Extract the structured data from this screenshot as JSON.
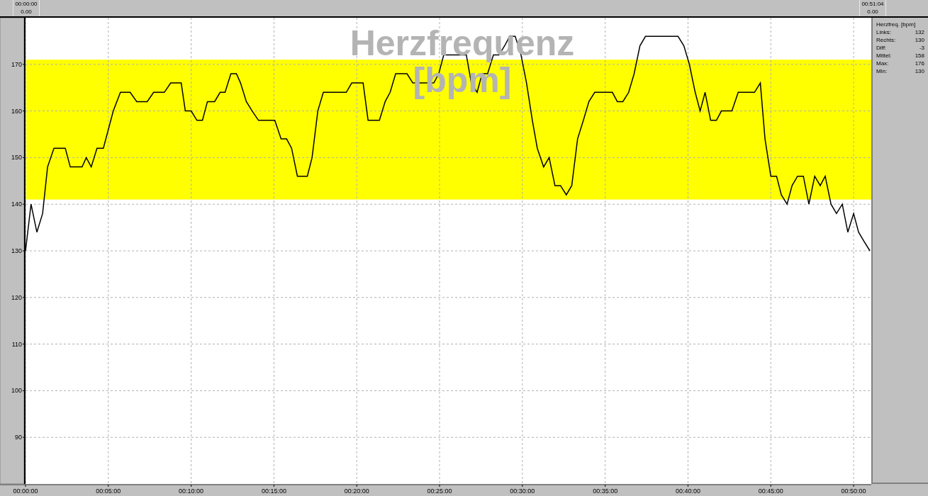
{
  "cursors": [
    {
      "time": "00:00:00",
      "value": "0.00"
    },
    {
      "time": "00:51:04",
      "value": "0.00"
    }
  ],
  "chart": {
    "chart_data": {
      "type": "line",
      "title": "Herzfrequenz [bpm]",
      "xlim": [
        0,
        3064
      ],
      "ylim": [
        80,
        180
      ],
      "xticks": [
        {
          "value": 0,
          "label": "00:00:00"
        },
        {
          "value": 300,
          "label": "00:05:00"
        },
        {
          "value": 600,
          "label": "00:10:00"
        },
        {
          "value": 900,
          "label": "00:15:00"
        },
        {
          "value": 1200,
          "label": "00:20:00"
        },
        {
          "value": 1500,
          "label": "00:25:00"
        },
        {
          "value": 1800,
          "label": "00:30:00"
        },
        {
          "value": 2100,
          "label": "00:35:00"
        },
        {
          "value": 2400,
          "label": "00:40:00"
        },
        {
          "value": 2700,
          "label": "00:45:00"
        },
        {
          "value": 3000,
          "label": "00:50:00"
        }
      ],
      "yticks": [
        90,
        100,
        110,
        120,
        130,
        140,
        150,
        160,
        170
      ],
      "grid": true,
      "bands": [
        {
          "axis": "y",
          "from": 141,
          "to": 171,
          "color": "#ffff00"
        }
      ],
      "x": [
        0,
        20,
        41,
        62,
        80,
        103,
        144,
        162,
        205,
        220,
        238,
        259,
        282,
        318,
        344,
        379,
        403,
        441,
        464,
        503,
        526,
        564,
        579,
        600,
        621,
        641,
        659,
        685,
        705,
        723,
        744,
        764,
        779,
        800,
        821,
        844,
        903,
        926,
        946,
        964,
        985,
        1021,
        1038,
        1059,
        1079,
        1162,
        1182,
        1223,
        1241,
        1282,
        1303,
        1321,
        1341,
        1382,
        1403,
        1479,
        1497,
        1515,
        1597,
        1615,
        1636,
        1654,
        1674,
        1695,
        1715,
        1736,
        1754,
        1774,
        1795,
        1815,
        1836,
        1854,
        1877,
        1897,
        1918,
        1938,
        1959,
        1979,
        2000,
        2021,
        2041,
        2062,
        2126,
        2144,
        2164,
        2185,
        2205,
        2226,
        2246,
        2364,
        2385,
        2405,
        2426,
        2444,
        2462,
        2482,
        2503,
        2521,
        2559,
        2582,
        2641,
        2662,
        2679,
        2700,
        2721,
        2738,
        2759,
        2777,
        2797,
        2818,
        2838,
        2859,
        2879,
        2897,
        2918,
        2938,
        2959,
        2979,
        3000,
        3018,
        3038,
        3059
      ],
      "series": [
        {
          "color": "#000000",
          "values": [
            130,
            140,
            134,
            138,
            148,
            152,
            152,
            148,
            148,
            150,
            148,
            152,
            152,
            160,
            164,
            164,
            162,
            162,
            164,
            164,
            166,
            166,
            160,
            160,
            158,
            158,
            162,
            162,
            164,
            164,
            168,
            168,
            166,
            162,
            160,
            158,
            158,
            154,
            154,
            152,
            146,
            146,
            150,
            160,
            164,
            164,
            166,
            166,
            158,
            158,
            162,
            164,
            168,
            168,
            166,
            166,
            168,
            172,
            172,
            166,
            164,
            168,
            168,
            172,
            172,
            174,
            176,
            176,
            172,
            166,
            158,
            152,
            148,
            150,
            144,
            144,
            142,
            144,
            154,
            158,
            162,
            164,
            164,
            162,
            162,
            164,
            168,
            174,
            176,
            176,
            174,
            170,
            164,
            160,
            164,
            158,
            158,
            160,
            160,
            164,
            164,
            166,
            154,
            146,
            146,
            142,
            140,
            144,
            146,
            146,
            140,
            146,
            144,
            146,
            140,
            138,
            140,
            134,
            138,
            134,
            132,
            130
          ]
        }
      ]
    }
  },
  "stats": {
    "title": "Herzfreq. [bpm]",
    "rows": [
      {
        "label": "Links:",
        "value": "132"
      },
      {
        "label": "Rechts:",
        "value": "130"
      },
      {
        "label": "Diff:",
        "value": "-3"
      },
      {
        "label": "Mittel:",
        "value": "158"
      },
      {
        "label": "Max:",
        "value": "176"
      },
      {
        "label": "Min:",
        "value": "130"
      }
    ]
  }
}
